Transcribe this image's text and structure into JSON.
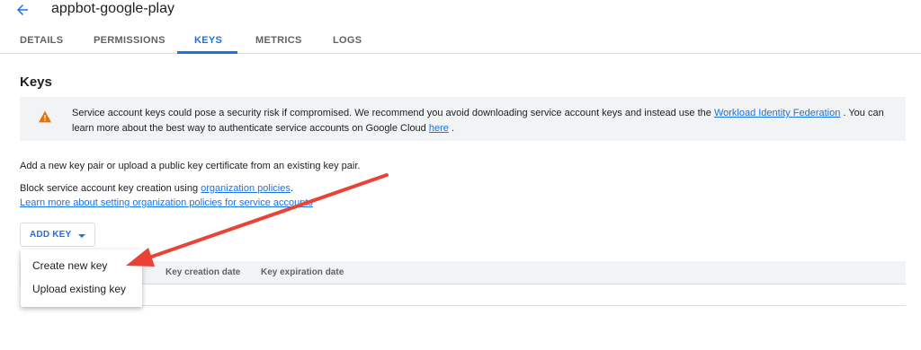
{
  "header": {
    "title": "appbot-google-play",
    "back_icon": "arrow-back-icon"
  },
  "tabs": [
    {
      "label": "DETAILS",
      "active": false
    },
    {
      "label": "PERMISSIONS",
      "active": false
    },
    {
      "label": "KEYS",
      "active": true
    },
    {
      "label": "METRICS",
      "active": false
    },
    {
      "label": "LOGS",
      "active": false
    }
  ],
  "keys_section": {
    "title": "Keys",
    "warning": {
      "icon": "warning-icon",
      "text_before": "Service account keys could pose a security risk if compromised. We recommend you avoid downloading service account keys and instead use the ",
      "link1": "Workload Identity Federation",
      "text_middle": " . You can learn more about the best way to authenticate service accounts on Google Cloud ",
      "link2": "here",
      "text_after": " ."
    },
    "add_key_info": "Add a new key pair or upload a public key certificate from an existing key pair.",
    "block_text": "Block service account key creation using ",
    "block_link": "organization policies",
    "block_text_end": ".",
    "learn_more_link": "Learn more about setting organization policies for service accounts"
  },
  "add_key_button": {
    "label": "ADD KEY",
    "caret_icon": "caret-down-icon"
  },
  "dropdown": {
    "items": [
      {
        "label": "Create new key"
      },
      {
        "label": "Upload existing key"
      }
    ]
  },
  "table": {
    "columns": [
      "Key creation date",
      "Key expiration date"
    ]
  },
  "colors": {
    "accent": "#1a73e8",
    "warning": "#e37400",
    "annotation_arrow": "#ea4335"
  }
}
